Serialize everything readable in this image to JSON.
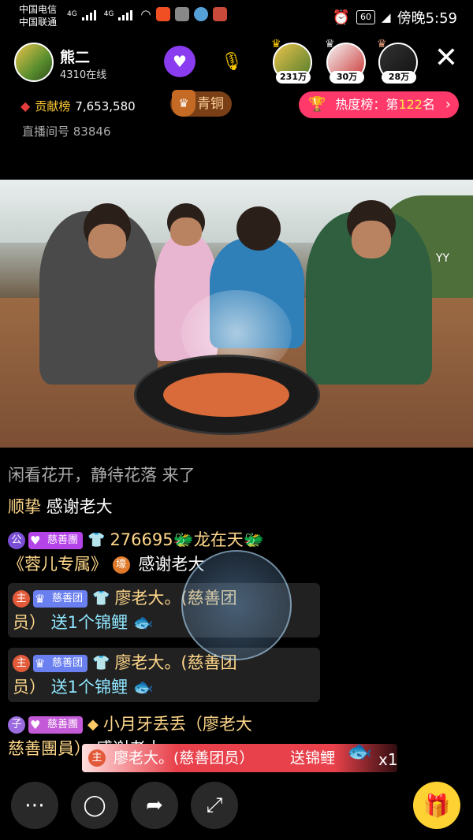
{
  "statusbar": {
    "carrier1": "中国电信",
    "carrier2": "中国联通",
    "signal1": "4G",
    "signal2": "4G",
    "battery": "60",
    "time": "傍晚5:59"
  },
  "header": {
    "host_name": "熊二",
    "online": "4310在线",
    "viewers": [
      {
        "badge": "231万"
      },
      {
        "badge": "30万"
      },
      {
        "badge": "28万"
      }
    ]
  },
  "contrib": {
    "label": "贡献榜",
    "value": "7,653,580"
  },
  "rank_badge": "青铜",
  "hot": {
    "label": "热度榜：第",
    "num": "122",
    "suffix": "名"
  },
  "room_id": "直播间号 83846",
  "video": {
    "watermark": "YY"
  },
  "chat": [
    {
      "text": "闲看花开，静待花落 来了"
    },
    {
      "user": "顺挚",
      "text": "感谢老大"
    },
    {
      "level": "公",
      "tag": "慈善團",
      "user": "276695🐲龙在天🐲",
      "user2": "《蓉儿专属》",
      "level2": "壕",
      "text": "感谢老大"
    },
    {
      "level": "主",
      "tag": "慈善团",
      "user": "廖老大。(慈善团",
      "user2": "员）",
      "text": "送1个锦鲤"
    },
    {
      "level": "主",
      "tag": "慈善团",
      "user": "廖老大。(慈善团",
      "user2": "员）",
      "text": "送1个锦鲤"
    },
    {
      "level": "子",
      "tag": "慈善團",
      "user": "小月牙丢丢（廖老大",
      "user2": "慈善團員）",
      "text": "感谢老大"
    }
  ],
  "banner": {
    "level": "主",
    "user": "廖老大。(慈善团员）",
    "text": "送锦鲤",
    "count": "x1"
  }
}
